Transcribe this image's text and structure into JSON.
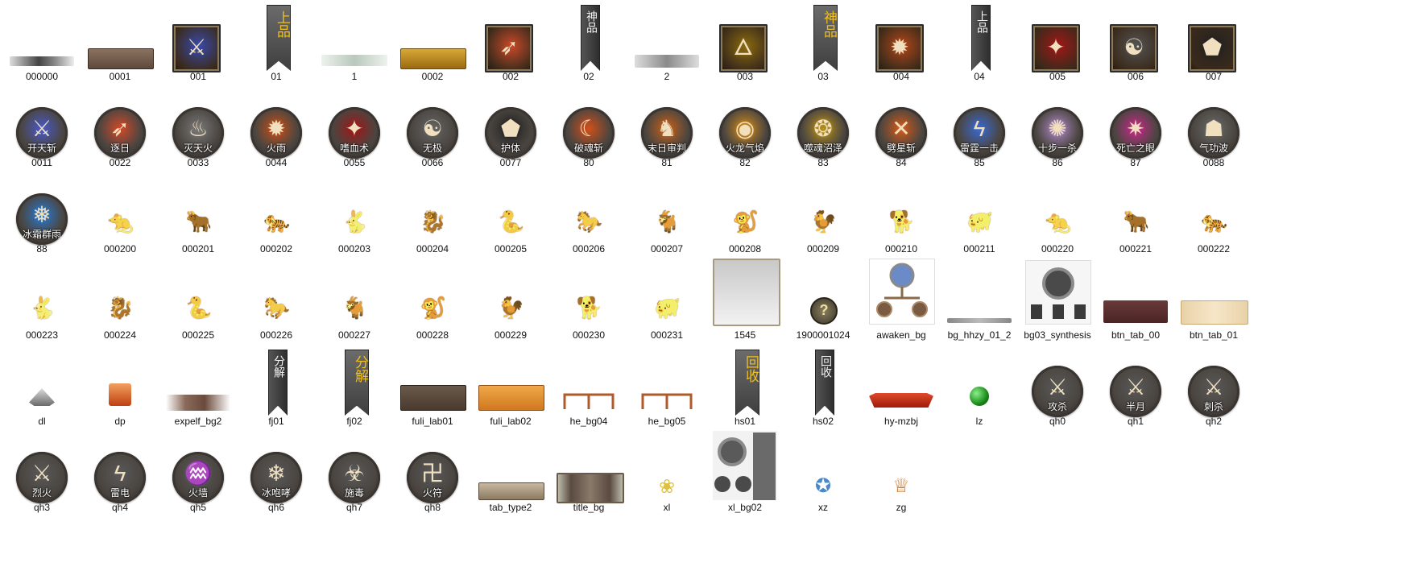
{
  "window": {
    "title": ""
  },
  "files": [
    {
      "name": "000000",
      "kind": "bar-dark-fade"
    },
    {
      "name": "0001",
      "kind": "bar-brown"
    },
    {
      "name": "001",
      "kind": "square-icon",
      "icon": "sword-icon",
      "color": "#3a4aa8"
    },
    {
      "name": "01",
      "kind": "tall-tag",
      "text": "上品",
      "tone": "gold"
    },
    {
      "name": "1",
      "kind": "bar-green-fade"
    },
    {
      "name": "0002",
      "kind": "bar-gold"
    },
    {
      "name": "002",
      "kind": "square-icon",
      "icon": "fire-slash-icon",
      "color": "#c84a2a"
    },
    {
      "name": "02",
      "kind": "tall-tag-narrow",
      "text": "神品",
      "tone": "white"
    },
    {
      "name": "2",
      "kind": "bar-silver"
    },
    {
      "name": "003",
      "kind": "square-icon",
      "icon": "flame-swirl-icon",
      "color": "#8a6a10"
    },
    {
      "name": "03",
      "kind": "tall-tag",
      "text": "神品",
      "tone": "gold"
    },
    {
      "name": "004",
      "kind": "square-icon",
      "icon": "flame-burst-icon",
      "color": "#b0481a"
    },
    {
      "name": "04",
      "kind": "tall-tag-narrow",
      "text": "上品",
      "tone": "white"
    },
    {
      "name": "005",
      "kind": "square-icon",
      "icon": "blood-bird-icon",
      "color": "#a01818"
    },
    {
      "name": "006",
      "kind": "square-icon",
      "icon": "yin-yang-icon",
      "color": "#555555"
    },
    {
      "name": "007",
      "kind": "square-icon",
      "icon": "pentagon-shield-icon",
      "color": "#222222"
    },
    {
      "name": "0011",
      "kind": "round-icon",
      "label": "开天斩",
      "icon": "sword-icon",
      "color": "#4a5ac8"
    },
    {
      "name": "0022",
      "kind": "round-icon",
      "label": "逐日",
      "icon": "fire-slash-icon",
      "color": "#d24a2a"
    },
    {
      "name": "0033",
      "kind": "round-icon",
      "label": "灭天火",
      "icon": "smoke-flame-icon",
      "color": "#7a7a7a"
    },
    {
      "name": "0044",
      "kind": "round-icon",
      "label": "火雨",
      "icon": "flame-burst-icon",
      "color": "#c8501a"
    },
    {
      "name": "0055",
      "kind": "round-icon",
      "label": "嗜血术",
      "icon": "blood-bird-icon",
      "color": "#a01818"
    },
    {
      "name": "0066",
      "kind": "round-icon",
      "label": "无极",
      "icon": "yin-yang-icon",
      "color": "#666666"
    },
    {
      "name": "0077",
      "kind": "round-icon",
      "label": "护体",
      "icon": "pentagon-shield-icon",
      "color": "#222222"
    },
    {
      "name": "80",
      "kind": "round-icon",
      "label": "破魂斩",
      "icon": "fire-crescent-icon",
      "color": "#d2501a"
    },
    {
      "name": "81",
      "kind": "round-icon",
      "label": "末日审判",
      "icon": "dragon-head-icon",
      "color": "#c8621a"
    },
    {
      "name": "82",
      "kind": "round-icon",
      "label": "火龙气焰",
      "icon": "flame-eye-icon",
      "color": "#d28a1a"
    },
    {
      "name": "83",
      "kind": "round-icon",
      "label": "噬魂沼泽",
      "icon": "swamp-flame-icon",
      "color": "#b8901a"
    },
    {
      "name": "84",
      "kind": "round-icon",
      "label": "劈星斩",
      "icon": "cross-slash-icon",
      "color": "#d25a1a"
    },
    {
      "name": "85",
      "kind": "round-icon",
      "label": "雷霆一击",
      "icon": "lightning-icon",
      "color": "#3a6ad2"
    },
    {
      "name": "86",
      "kind": "round-icon",
      "label": "十步一杀",
      "icon": "white-burst-icon",
      "color": "#b08ac8"
    },
    {
      "name": "87",
      "kind": "round-icon",
      "label": "死亡之眼",
      "icon": "magic-eye-icon",
      "color": "#c82a8a"
    },
    {
      "name": "0088",
      "kind": "round-icon",
      "label": "气功波",
      "icon": "ghost-aura-icon",
      "color": "#6a6a6a"
    },
    {
      "name": "88",
      "kind": "round-icon",
      "label": "冰霜群雨",
      "icon": "ice-spike-icon",
      "color": "#2a7ad2"
    },
    {
      "name": "000200",
      "kind": "zodiac",
      "icon": "rat-icon",
      "glyph": "🐀"
    },
    {
      "name": "000201",
      "kind": "zodiac",
      "icon": "ox-icon",
      "glyph": "🐂"
    },
    {
      "name": "000202",
      "kind": "zodiac",
      "icon": "tiger-icon",
      "glyph": "🐅"
    },
    {
      "name": "000203",
      "kind": "zodiac",
      "icon": "rabbit-icon",
      "glyph": "🐇"
    },
    {
      "name": "000204",
      "kind": "zodiac",
      "icon": "dragon-icon",
      "glyph": "🐉"
    },
    {
      "name": "000205",
      "kind": "zodiac",
      "icon": "snake-icon",
      "glyph": "🐍"
    },
    {
      "name": "000206",
      "kind": "zodiac",
      "icon": "horse-icon",
      "glyph": "🐎"
    },
    {
      "name": "000207",
      "kind": "zodiac",
      "icon": "goat-icon",
      "glyph": "🐐"
    },
    {
      "name": "000208",
      "kind": "zodiac",
      "icon": "monkey-icon",
      "glyph": "🐒"
    },
    {
      "name": "000209",
      "kind": "zodiac",
      "icon": "rooster-icon",
      "glyph": "🐓"
    },
    {
      "name": "000210",
      "kind": "zodiac",
      "icon": "dog-icon",
      "glyph": "🐕"
    },
    {
      "name": "000211",
      "kind": "zodiac",
      "icon": "pig-icon",
      "glyph": "🐖"
    },
    {
      "name": "000220",
      "kind": "zodiac",
      "icon": "rat-icon",
      "glyph": "🐀"
    },
    {
      "name": "000221",
      "kind": "zodiac",
      "icon": "ox-icon",
      "glyph": "🐂"
    },
    {
      "name": "000222",
      "kind": "zodiac",
      "icon": "tiger-icon",
      "glyph": "🐅"
    },
    {
      "name": "000223",
      "kind": "zodiac",
      "icon": "rabbit-icon",
      "glyph": "🐇"
    },
    {
      "name": "000224",
      "kind": "zodiac",
      "icon": "dragon-icon",
      "glyph": "🐉"
    },
    {
      "name": "000225",
      "kind": "zodiac",
      "icon": "snake-icon",
      "glyph": "🐍"
    },
    {
      "name": "000226",
      "kind": "zodiac",
      "icon": "horse-icon",
      "glyph": "🐎"
    },
    {
      "name": "000227",
      "kind": "zodiac",
      "icon": "goat-icon",
      "glyph": "🐐"
    },
    {
      "name": "000228",
      "kind": "zodiac",
      "icon": "monkey-icon",
      "glyph": "🐒"
    },
    {
      "name": "000229",
      "kind": "zodiac",
      "icon": "rooster-icon",
      "glyph": "🐓"
    },
    {
      "name": "000230",
      "kind": "zodiac",
      "icon": "dog-icon",
      "glyph": "🐕"
    },
    {
      "name": "000231",
      "kind": "zodiac",
      "icon": "pig-icon",
      "glyph": "🐖"
    },
    {
      "name": "1545",
      "kind": "panel-silver"
    },
    {
      "name": "1900001024",
      "kind": "question-coin",
      "glyph": "?"
    },
    {
      "name": "awaken_bg",
      "kind": "awaken-tree"
    },
    {
      "name": "bg_hhzy_01_2",
      "kind": "bar-thin-gray"
    },
    {
      "name": "bg03_synthesis",
      "kind": "synthesis"
    },
    {
      "name": "btn_tab_00",
      "kind": "bar-maroon"
    },
    {
      "name": "btn_tab_01",
      "kind": "bar-cream"
    },
    {
      "name": "dl",
      "kind": "stone",
      "icon": "crystal-pile-icon"
    },
    {
      "name": "dp",
      "kind": "box",
      "icon": "treasure-box-icon"
    },
    {
      "name": "expelf_bg2",
      "kind": "bar-brown-fade"
    },
    {
      "name": "fj01",
      "kind": "tall-tag-narrow",
      "text": "分解",
      "tone": "white"
    },
    {
      "name": "fj02",
      "kind": "tall-tag",
      "text": "分解",
      "tone": "gold"
    },
    {
      "name": "fuli_lab01",
      "kind": "bar-dark-brown"
    },
    {
      "name": "fuli_lab02",
      "kind": "bar-orange"
    },
    {
      "name": "he_bg04",
      "kind": "fork-line"
    },
    {
      "name": "he_bg05",
      "kind": "fork-line"
    },
    {
      "name": "hs01",
      "kind": "tall-tag",
      "text": "回收",
      "tone": "gold"
    },
    {
      "name": "hs02",
      "kind": "tall-tag-narrow",
      "text": "回收",
      "tone": "white"
    },
    {
      "name": "hy-mzbj",
      "kind": "ribbon"
    },
    {
      "name": "lz",
      "kind": "orb",
      "icon": "green-orb-icon"
    },
    {
      "name": "qh0",
      "kind": "round-icon",
      "label": "攻杀",
      "icon": "sword-icon",
      "color": "#5a5a5a"
    },
    {
      "name": "qh1",
      "kind": "round-icon",
      "label": "半月",
      "icon": "sword-icon",
      "color": "#5a5a5a"
    },
    {
      "name": "qh2",
      "kind": "round-icon",
      "label": "刺杀",
      "icon": "sword-icon",
      "color": "#5a5a5a"
    },
    {
      "name": "qh3",
      "kind": "round-icon",
      "label": "烈火",
      "icon": "sword-icon",
      "color": "#5a5a5a"
    },
    {
      "name": "qh4",
      "kind": "round-icon",
      "label": "雷电",
      "icon": "lightning-icon",
      "color": "#5a5a5a"
    },
    {
      "name": "qh5",
      "kind": "round-icon",
      "label": "火墙",
      "icon": "fire-wall-icon",
      "color": "#5a5a5a"
    },
    {
      "name": "qh6",
      "kind": "round-icon",
      "label": "冰咆哮",
      "icon": "snowflake-icon",
      "color": "#5a5a5a"
    },
    {
      "name": "qh7",
      "kind": "round-icon",
      "label": "施毒",
      "icon": "poison-icon",
      "color": "#5a5a5a"
    },
    {
      "name": "qh8",
      "kind": "round-icon",
      "label": "火符",
      "icon": "talisman-icon",
      "color": "#5a5a5a"
    },
    {
      "name": "tab_type2",
      "kind": "bar-tab-beige"
    },
    {
      "name": "title_bg",
      "kind": "bar-title"
    },
    {
      "name": "xl",
      "kind": "lotus",
      "icon": "lotus-icon"
    },
    {
      "name": "xl_bg02",
      "kind": "xl-bg"
    },
    {
      "name": "xz",
      "kind": "badge",
      "icon": "wing-badge-icon"
    },
    {
      "name": "zg",
      "kind": "goblet",
      "icon": "goblet-icon"
    }
  ]
}
